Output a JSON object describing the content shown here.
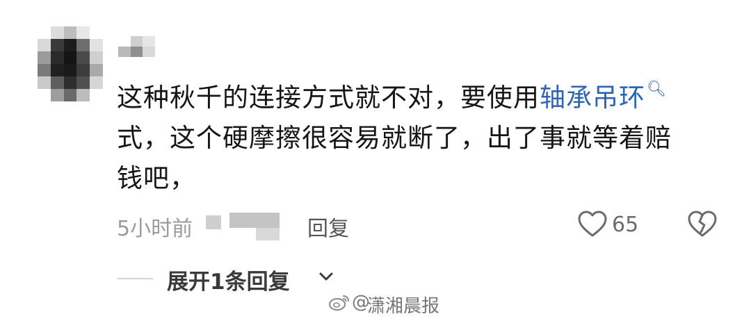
{
  "comment": {
    "line1_prefix": "这种秋千的连接方式就不对，要使用",
    "link_text": "轴承吊环",
    "line1_suffix": "",
    "line2": "式，这个硬摩擦很容易就断了，出了事就等着赔",
    "line3": "钱吧，"
  },
  "meta": {
    "time": "5小时前",
    "reply_label": "回复",
    "like_count": "65"
  },
  "replies": {
    "expand_label": "展开1条回复"
  },
  "watermark": {
    "at": "@",
    "text": "潇湘晨报"
  },
  "colors": {
    "link": "#2f64b6",
    "text": "#151515",
    "muted": "#9a9a9a"
  }
}
